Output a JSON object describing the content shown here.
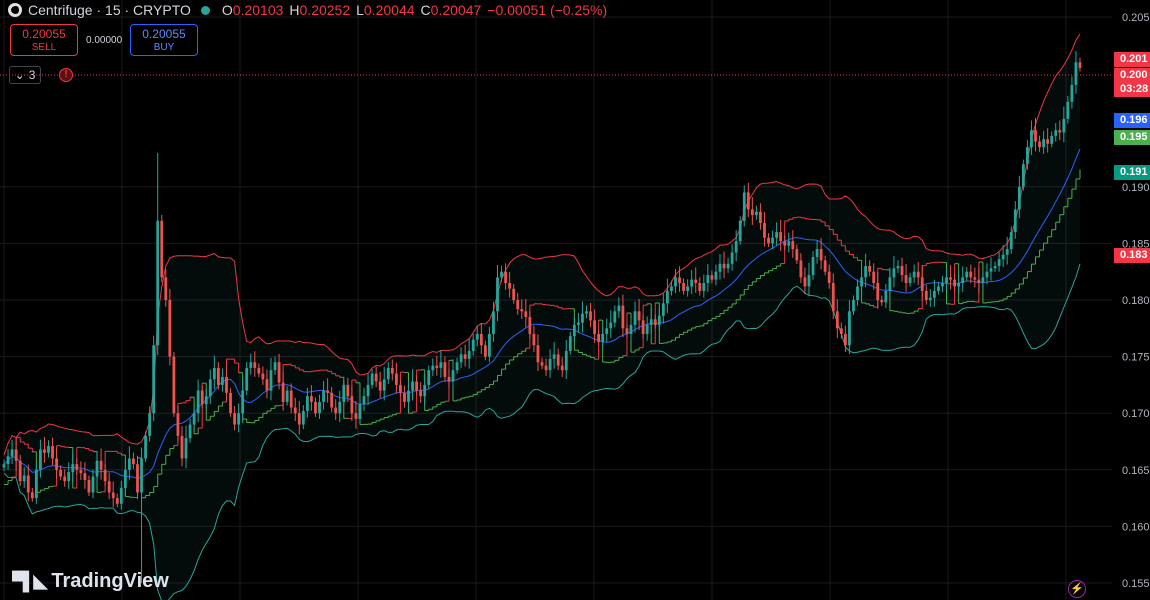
{
  "header": {
    "symbol": "Centrifuge · 15 · CRYPTO",
    "open_label": "O",
    "open": "0.20103",
    "high_label": "H",
    "high": "0.20252",
    "low_label": "L",
    "low": "0.20044",
    "close_label": "C",
    "close": "0.20047",
    "change": "−0.00051 (−0.25%)"
  },
  "trade": {
    "sell_price": "0.20055",
    "sell_label": "SELL",
    "spread": "0.00000",
    "buy_price": "0.20055",
    "buy_label": "BUY"
  },
  "indicator_count": "3",
  "brand": "TradingView",
  "price_tags": [
    {
      "text": "0.201",
      "color": "#f23645"
    },
    {
      "text": "0.200",
      "color": "#f23645"
    },
    {
      "text": "03:28",
      "color": "#f23645"
    },
    {
      "text": "0.196",
      "color": "#2962ff"
    },
    {
      "text": "0.195",
      "color": "#4caf50"
    },
    {
      "text": "0.191",
      "color": "#089981"
    },
    {
      "text": "0.183",
      "color": "#f23645"
    }
  ],
  "colors": {
    "background": "#000000",
    "up": "#26a69a",
    "down": "#ef5350",
    "upper_band": "#f23645",
    "lower_band": "#26a69a",
    "mid": "#2962ff",
    "support": "#4caf50",
    "resistance": "#f23645",
    "grid": "#1a1a1a"
  },
  "chart_data": {
    "type": "candlestick",
    "y_ticks": [
      "0.205",
      "0.190",
      "0.185",
      "0.180",
      "0.175",
      "0.170",
      "0.165",
      "0.160",
      "0.155"
    ],
    "ylim": [
      0.1535,
      0.2065
    ],
    "last_price": 0.20047,
    "grid": true,
    "indicators": [
      "bollinger_bands",
      "moving_average",
      "supertrend"
    ],
    "close": [
      0.1655,
      0.1662,
      0.1668,
      0.1658,
      0.164,
      0.1645,
      0.163,
      0.1625,
      0.165,
      0.1668,
      0.1665,
      0.1671,
      0.166,
      0.165,
      0.1644,
      0.164,
      0.1648,
      0.1655,
      0.165,
      0.1647,
      0.1641,
      0.163,
      0.1644,
      0.1658,
      0.165,
      0.164,
      0.163,
      0.1625,
      0.162,
      0.1634,
      0.165,
      0.166,
      0.1655,
      0.163,
      0.166,
      0.168,
      0.17,
      0.176,
      0.187,
      0.182,
      0.18,
      0.175,
      0.17,
      0.168,
      0.166,
      0.1678,
      0.169,
      0.17,
      0.172,
      0.1708,
      0.1715,
      0.173,
      0.174,
      0.1725,
      0.1732,
      0.1718,
      0.17,
      0.169,
      0.17,
      0.172,
      0.174,
      0.1745,
      0.174,
      0.1735,
      0.173,
      0.172,
      0.1738,
      0.1745,
      0.1727,
      0.171,
      0.172,
      0.1705,
      0.17,
      0.169,
      0.1702,
      0.1715,
      0.171,
      0.17,
      0.171,
      0.172,
      0.1718,
      0.1705,
      0.17,
      0.171,
      0.1725,
      0.1715,
      0.17,
      0.1695,
      0.1708,
      0.1715,
      0.1725,
      0.1735,
      0.1728,
      0.172,
      0.173,
      0.174,
      0.1735,
      0.1725,
      0.1718,
      0.171,
      0.172,
      0.1728,
      0.172,
      0.1715,
      0.1725,
      0.1738,
      0.1742,
      0.174,
      0.1745,
      0.1732,
      0.1728,
      0.1738,
      0.1745,
      0.1752,
      0.1748,
      0.1755,
      0.1765,
      0.177,
      0.176,
      0.175,
      0.177,
      0.179,
      0.182,
      0.1825,
      0.1815,
      0.181,
      0.18,
      0.1792,
      0.179,
      0.1785,
      0.177,
      0.176,
      0.1745,
      0.1742,
      0.1738,
      0.1748,
      0.1752,
      0.1742,
      0.1738,
      0.1755,
      0.1768,
      0.1778,
      0.178,
      0.1788,
      0.179,
      0.1782,
      0.177,
      0.1763,
      0.177,
      0.1775,
      0.178,
      0.179,
      0.1795,
      0.1775,
      0.177,
      0.1778,
      0.179,
      0.1782,
      0.177,
      0.1778,
      0.1783,
      0.1778,
      0.1786,
      0.1797,
      0.1808,
      0.1812,
      0.182,
      0.1815,
      0.1808,
      0.1812,
      0.1818,
      0.1815,
      0.1808,
      0.1815,
      0.1822,
      0.1818,
      0.1825,
      0.1832,
      0.1828,
      0.1832,
      0.1842,
      0.1852,
      0.187,
      0.1895,
      0.188,
      0.1875,
      0.1878,
      0.1868,
      0.1855,
      0.185,
      0.1855,
      0.186,
      0.1852,
      0.1848,
      0.1852,
      0.1845,
      0.1835,
      0.182,
      0.1812,
      0.1822,
      0.1838,
      0.1845,
      0.1835,
      0.1825,
      0.1815,
      0.179,
      0.1775,
      0.177,
      0.176,
      0.179,
      0.18,
      0.1812,
      0.182,
      0.183,
      0.1825,
      0.1815,
      0.18,
      0.1798,
      0.1808,
      0.182,
      0.1828,
      0.183,
      0.1822,
      0.1815,
      0.182,
      0.1825,
      0.182,
      0.1808,
      0.18,
      0.1802,
      0.1808,
      0.1812,
      0.1815,
      0.182,
      0.1818,
      0.1812,
      0.1815,
      0.182,
      0.1825,
      0.182,
      0.1818,
      0.1815,
      0.182,
      0.1825,
      0.1828,
      0.183,
      0.1836,
      0.184,
      0.1845,
      0.186,
      0.188,
      0.19,
      0.192,
      0.1935,
      0.195,
      0.194,
      0.1935,
      0.1942,
      0.1938,
      0.1945,
      0.195,
      0.1948,
      0.196,
      0.1975,
      0.199,
      0.201,
      0.2005
    ]
  }
}
